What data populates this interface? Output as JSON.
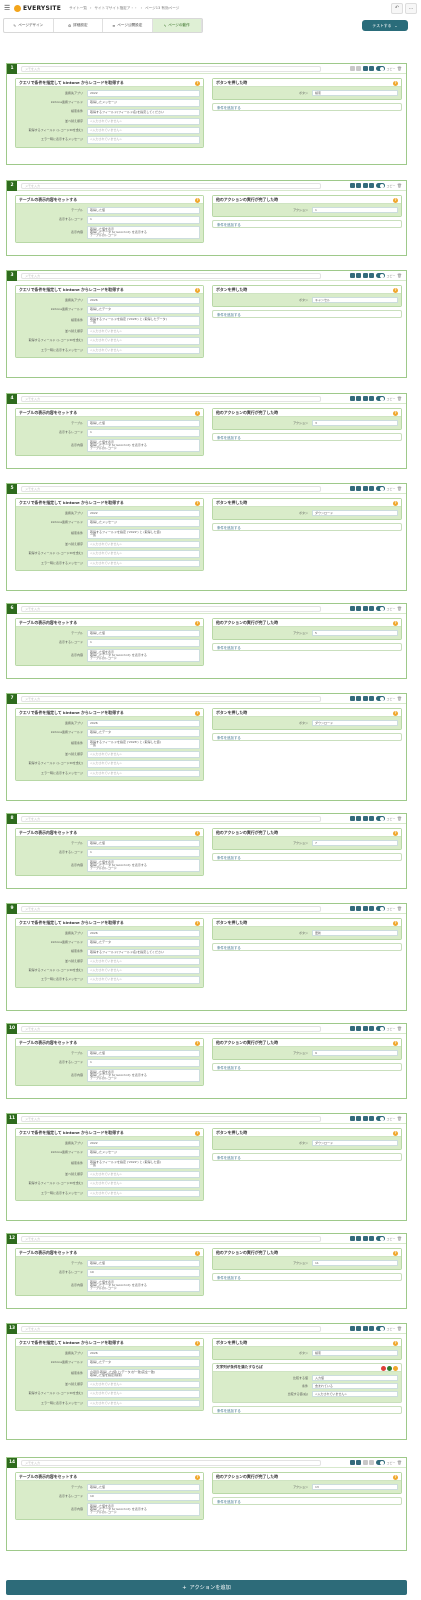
{
  "header": {
    "menu_icon": "hamburger-icon",
    "logo": "EVERYSITE",
    "breadcrumbs": [
      "サイト一覧",
      "サイトマサイト指定ア・・",
      "ページ13 有効ページ"
    ],
    "undo_icon": "undo-icon",
    "more_icon": "ellipsis-icon"
  },
  "tabs": [
    {
      "label": "ページデザイン",
      "icon": "brush-icon"
    },
    {
      "label": "詳細設定",
      "icon": "gear-icon"
    },
    {
      "label": "ページ公開設定",
      "icon": "list-icon"
    },
    {
      "label": "ページの動作",
      "icon": "bolt-icon"
    }
  ],
  "test_button": {
    "label": "テストする",
    "icon": "chevron-down-icon"
  },
  "memo_placeholder": "メモを入力",
  "copy_label": "コピー",
  "add_condition_label": "条件を追加する",
  "add_action_label": "アクションを追加",
  "actions": [
    {
      "num": "1",
      "type": "query",
      "fields": [
        [
          "連携先アプリ",
          "2022"
        ],
        [
          "kintone連携フィールド",
          "取得したメッセージ"
        ],
        [
          "検索条件",
          "取得するフィールド(フィールド名)を指定してください"
        ],
        [
          "並べ替え順序",
          "<入力されていません>"
        ],
        [
          "取得するフィールド (レコードIDを含む)",
          "<入力されていません>"
        ],
        [
          "エラー時に表示するメッセージ",
          "<入力されていません>"
        ]
      ],
      "right": {
        "type": "button",
        "title": "ボタンを押した時",
        "label": "ボタン",
        "value": "検索"
      }
    },
    {
      "num": "2",
      "type": "table",
      "fields": [
        [
          "テーブル",
          "取得した値"
        ],
        [
          "表示するレコード",
          "1"
        ],
        [
          "表示内容",
          "取得した値を表示\n取得したデータ ${record.id} を表示する\nテーブルのレコード"
        ]
      ],
      "right": {
        "type": "after",
        "title": "他のアクションの実行が完了した時",
        "label": "アクション",
        "value": "1"
      }
    },
    {
      "num": "3",
      "type": "query",
      "fields": [
        [
          "連携先アプリ",
          "2026"
        ],
        [
          "kintone連携フィールド",
          "取得したデータ"
        ],
        [
          "検索条件",
          "取得するフィールドを指定 ('2026') と (取得したデータ)\n一覧"
        ],
        [
          "並べ替え順序",
          "<入力されていません>"
        ],
        [
          "取得するフィールド (レコードIDを含む)",
          "<入力されていません>"
        ],
        [
          "エラー時に表示するメッセージ",
          "<入力されていません>"
        ]
      ],
      "right": {
        "type": "button",
        "title": "ボタンを押した時",
        "label": "ボタン",
        "value": "キャンセル"
      }
    },
    {
      "num": "4",
      "type": "table",
      "fields": [
        [
          "テーブル",
          "取得した値"
        ],
        [
          "表示するレコード",
          "1"
        ],
        [
          "表示内容",
          "取得した値を表示\n取得したデータ ${record.id} を表示する\nテーブルのレコード"
        ]
      ],
      "right": {
        "type": "after",
        "title": "他のアクションの実行が完了した時",
        "label": "アクション",
        "value": "3"
      }
    },
    {
      "num": "5",
      "type": "query",
      "fields": [
        [
          "連携先アプリ",
          "2022"
        ],
        [
          "kintone連携フィールド",
          "取得したメッセージ"
        ],
        [
          "検索条件",
          "取得するフィールドを指定 ('2022') と (取得した値)\n一覧"
        ],
        [
          "並べ替え順序",
          "<入力されていません>"
        ],
        [
          "取得するフィールド (レコードIDを含む)",
          "<入力されていません>"
        ],
        [
          "エラー時に表示するメッセージ",
          "<入力されていません>"
        ]
      ],
      "right": {
        "type": "button",
        "title": "ボタンを押した時",
        "label": "ボタン",
        "value": "ダウンロード"
      }
    },
    {
      "num": "6",
      "type": "table",
      "fields": [
        [
          "テーブル",
          "取得した値"
        ],
        [
          "表示するレコード",
          "1"
        ],
        [
          "表示内容",
          "取得した値を表示\n取得したデータ ${record.id} を表示する\nテーブルのレコード"
        ]
      ],
      "right": {
        "type": "after",
        "title": "他のアクションの実行が完了した時",
        "label": "アクション",
        "value": "5"
      }
    },
    {
      "num": "7",
      "type": "query",
      "fields": [
        [
          "連携先アプリ",
          "2026"
        ],
        [
          "kintone連携フィールド",
          "取得したデータ"
        ],
        [
          "検索条件",
          "取得するフィールドを指定 ('2026') と (取得した値)\n一覧"
        ],
        [
          "並べ替え順序",
          "<入力されていません>"
        ],
        [
          "取得するフィールド (レコードIDを含む)",
          "<入力されていません>"
        ],
        [
          "エラー時に表示するメッセージ",
          "<入力されていません>"
        ]
      ],
      "right": {
        "type": "button",
        "title": "ボタンを押した時",
        "label": "ボタン",
        "value": "ダウンロード"
      }
    },
    {
      "num": "8",
      "type": "table",
      "fields": [
        [
          "テーブル",
          "取得した値"
        ],
        [
          "表示するレコード",
          "1"
        ],
        [
          "表示内容",
          "取得した値を表示\n取得したデータ ${record.id} を表示する\nテーブルのレコード"
        ]
      ],
      "right": {
        "type": "after",
        "title": "他のアクションの実行が完了した時",
        "label": "アクション",
        "value": "7"
      }
    },
    {
      "num": "9",
      "type": "query",
      "fields": [
        [
          "連携先アプリ",
          "2026"
        ],
        [
          "kintone連携フィールド",
          "取得したデータ"
        ],
        [
          "検索条件",
          "取得するフィールド(フィールド名)を指定してください"
        ],
        [
          "並べ替え順序",
          "<入力されていません>"
        ],
        [
          "取得するフィールド (レコードIDを含む)",
          "<入力されていません>"
        ],
        [
          "エラー時に表示するメッセージ",
          "<入力されていません>"
        ]
      ],
      "right": {
        "type": "button",
        "title": "ボタンを押した時",
        "label": "ボタン",
        "value": "更新"
      }
    },
    {
      "num": "10",
      "type": "table",
      "fields": [
        [
          "テーブル",
          "取得した値"
        ],
        [
          "表示するレコード",
          "1"
        ],
        [
          "表示内容",
          "取得した値を表示\n取得したデータ ${record.id} を表示する\nテーブルのレコード"
        ]
      ],
      "right": {
        "type": "after",
        "title": "他のアクションの実行が完了した時",
        "label": "アクション",
        "value": "9"
      }
    },
    {
      "num": "11",
      "type": "query",
      "fields": [
        [
          "連携先アプリ",
          "2022"
        ],
        [
          "kintone連携フィールド",
          "取得したメッセージ"
        ],
        [
          "検索条件",
          "取得するフィールドを指定 ('2022') と (取得した値)\n一覧"
        ],
        [
          "並べ替え順序",
          "<入力されていません>"
        ],
        [
          "取得するフィールド (レコードIDを含む)",
          "<入力されていません>"
        ],
        [
          "エラー時に表示するメッセージ",
          "<入力されていません>"
        ]
      ],
      "right": {
        "type": "button",
        "title": "ボタンを押した時",
        "label": "ボタン",
        "value": "ダウンロード"
      }
    },
    {
      "num": "12",
      "type": "table",
      "fields": [
        [
          "テーブル",
          "取得した値"
        ],
        [
          "表示するレコード",
          "10"
        ],
        [
          "表示内容",
          "取得した値を表示\n取得したデータ ${record.id} を表示する\nテーブルのレコード"
        ]
      ],
      "right": {
        "type": "after",
        "title": "他のアクションの実行が完了した時",
        "label": "アクション",
        "value": "11"
      }
    },
    {
      "num": "13",
      "type": "query",
      "fields": [
        [
          "連携先アプリ",
          "2026"
        ],
        [
          "kintone連携フィールド",
          "取得したデータ"
        ],
        [
          "検索条件",
          "の項目:取得した(値)と(データ)が一致(完全一致)\n取得した値を指定(検索)"
        ],
        [
          "並べ替え順序",
          "<入力されていません>"
        ],
        [
          "取得するフィールド (レコードIDを含む)",
          "<入力されていません>"
        ],
        [
          "エラー時に表示するメッセージ",
          "<入力されていません>"
        ]
      ],
      "right": {
        "type": "button",
        "title": "ボタンを押した時",
        "label": "ボタン",
        "value": "検索",
        "cond": {
          "title": "文字列が条件を満たすならば",
          "rows": [
            [
              "比較する値",
              "入力値"
            ],
            [
              "条件",
              "含まれている"
            ],
            [
              "比較する値(右)",
              "<入力されていません>"
            ]
          ]
        }
      }
    },
    {
      "num": "14",
      "type": "table",
      "fields": [
        [
          "テーブル",
          "取得した値"
        ],
        [
          "表示するレコード",
          "10"
        ],
        [
          "表示内容",
          "取得した値を表示\n取得したデータ ${record.id} を表示する\nテーブルのレコード"
        ]
      ],
      "right": {
        "type": "after",
        "title": "他のアクションの実行が完了した時",
        "label": "アクション",
        "value": "13"
      }
    }
  ],
  "panel_titles": {
    "query": "クエリで条件を指定して kintone からレコードを取得する",
    "table": "テーブルの表示内容をセットする"
  },
  "colors": {
    "brand": "#2e6b1d",
    "accent": "#2d6b79",
    "panel_fill": "#d9ecc9",
    "help": "#f0a72b"
  }
}
